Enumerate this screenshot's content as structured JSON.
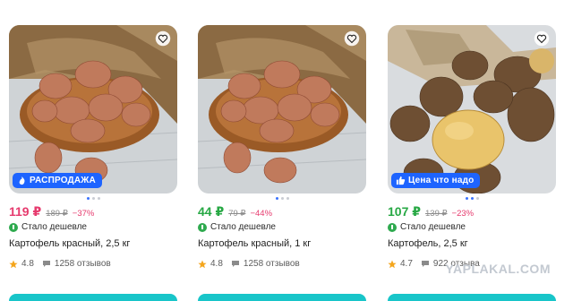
{
  "products": [
    {
      "price": "119 ₽",
      "price_color": "#e63b6e",
      "old_price": "189 ₽",
      "discount": "−37%",
      "cheaper_label": "Стало дешевле",
      "title": "Картофель красный, 2,5 кг",
      "rating": "4.8",
      "reviews": "1258 отзывов",
      "badge": "РАСПРОДАЖА",
      "badge_icon": "fire-icon",
      "photo": "red-potatoes-in-bowl",
      "dots": [
        true,
        false,
        false
      ]
    },
    {
      "price": "44 ₽",
      "price_color": "#27a844",
      "old_price": "79 ₽",
      "discount": "−44%",
      "cheaper_label": "Стало дешевле",
      "title": "Картофель красный, 1 кг",
      "rating": "4.8",
      "reviews": "1258 отзывов",
      "badge": "",
      "photo": "red-potatoes-in-bowl",
      "dots": [
        true,
        false,
        false
      ]
    },
    {
      "price": "107 ₽",
      "price_color": "#27a844",
      "old_price": "139 ₽",
      "discount": "−23%",
      "cheaper_label": "Стало дешевле",
      "title": "Картофель, 2,5 кг",
      "rating": "4.7",
      "reviews": "922 отзыва",
      "badge": "Цена что надо",
      "badge_icon": "thumbs-up-icon",
      "photo": "yellow-potatoes",
      "dots": [
        true,
        true,
        false
      ]
    }
  ],
  "watermark": "YAPLAKAL.COM"
}
